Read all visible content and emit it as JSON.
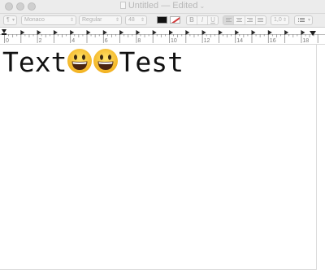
{
  "window": {
    "title": "Untitled",
    "title_status": "— Edited",
    "title_chevron": "⌄"
  },
  "toolbar": {
    "paragraph_style": "¶",
    "font_family": "Monaco",
    "font_style": "Regular",
    "font_size": "48",
    "bold_label": "B",
    "italic_label": "I",
    "underline_label": "U",
    "line_spacing": "1,0",
    "text_color": "#000000"
  },
  "ruler": {
    "numbers": [
      "0",
      "2",
      "4",
      "6",
      "8",
      "10",
      "12",
      "14",
      "16",
      "18"
    ]
  },
  "document": {
    "text_before": "Text",
    "emoji_names": [
      "grinning-face-emoji",
      "grinning-face-emoji"
    ],
    "text_after": "Test"
  }
}
